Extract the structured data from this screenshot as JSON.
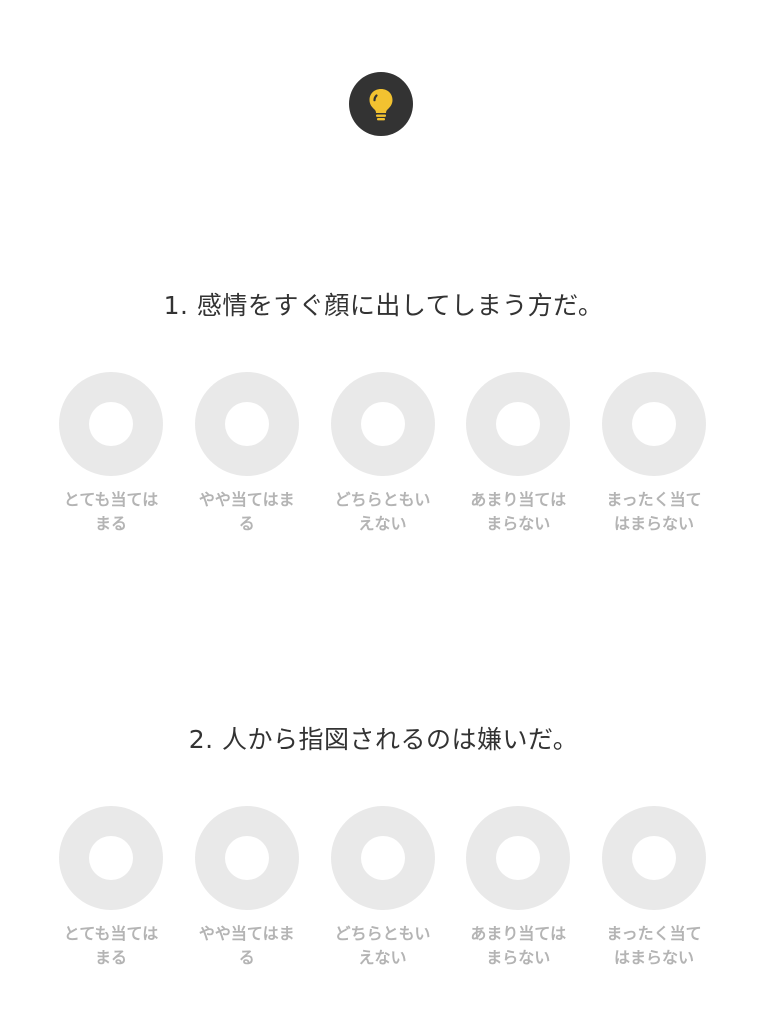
{
  "logo": {
    "icon": "lightbulb-icon",
    "background": "#333333",
    "accent": "#f2c230"
  },
  "questions": [
    {
      "title": "1. 感情をすぐ顔に出してしまう方だ。",
      "options": [
        {
          "label": "とても当てはまる"
        },
        {
          "label": "やや当てはまる"
        },
        {
          "label": "どちらともいえない"
        },
        {
          "label": "あまり当てはまらない"
        },
        {
          "label": "まったく当てはまらない"
        }
      ]
    },
    {
      "title": "2. 人から指図されるのは嫌いだ。",
      "options": [
        {
          "label": "とても当てはまる"
        },
        {
          "label": "やや当てはまる"
        },
        {
          "label": "どちらともいえない"
        },
        {
          "label": "あまり当てはまらない"
        },
        {
          "label": "まったく当てはまらない"
        }
      ]
    }
  ],
  "colors": {
    "radio_ring": "#e9e9e9",
    "label_text": "#b4b4b4",
    "title_text": "#333333"
  }
}
